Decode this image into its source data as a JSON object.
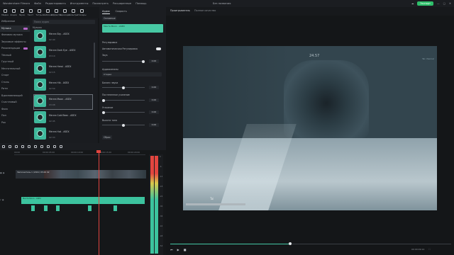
{
  "titlebar": {
    "menu": [
      "Wondershare Filmora",
      "Файл",
      "Редактировать",
      "Инструменты",
      "Посмотреть",
      "Расширенные",
      "Помощь",
      "Картик"
    ],
    "project_title": "Без названия",
    "export_label": "Экспорт"
  },
  "toolbar": {
    "tools": [
      "Медиа",
      "Акции",
      "Звуки",
      "Текст",
      "Титры",
      "Шаблоны",
      "Эффекты",
      "Переходы",
      "Фильтры",
      "Стикеры"
    ]
  },
  "sidebar": {
    "items": [
      {
        "label": "Избранное"
      },
      {
        "label": "Музыка",
        "selected": true
      },
      {
        "label": "Фоновая музыка"
      },
      {
        "label": "Звуковые эффекты"
      },
      {
        "label": "Рекомендации"
      },
      {
        "label": "Тёмный"
      },
      {
        "label": "Грустный"
      },
      {
        "label": "Мечтательный"
      },
      {
        "label": "Спорт"
      },
      {
        "label": "Стиль"
      },
      {
        "label": "Ритм"
      },
      {
        "label": "Вдохновляющий"
      },
      {
        "label": "Счастливый"
      },
      {
        "label": "Фолк"
      },
      {
        "label": "Поп"
      },
      {
        "label": "Рок"
      }
    ]
  },
  "media": {
    "search_placeholder": "Поиск аудио",
    "header": "Музыка",
    "tracks": [
      {
        "name": "Мечта Sky - ASEX",
        "duration": "02:40"
      },
      {
        "name": "Мечта Dark Eye - ASEX",
        "duration": "03:10"
      },
      {
        "name": "Мечта Heroi - ASEX",
        "duration": "02:15"
      },
      {
        "name": "Мечта Hik - ASEX",
        "duration": "02:50"
      },
      {
        "name": "Мечта Moon - ASEX",
        "duration": "03:08",
        "selected": true
      },
      {
        "name": "Мечта Cold Bear - ASEX",
        "duration": "02:45"
      },
      {
        "name": "Мечта Hot - ASEX",
        "duration": "02:33"
      }
    ]
  },
  "props": {
    "tabs": [
      "Аудио",
      "Скорость"
    ],
    "subtab": "Основные",
    "clip_label": "Мечта Moon - ASEX",
    "section": "Регулировка",
    "auto_label": "Автоматическая Регулировка",
    "volume_label": "Звук",
    "volume_value": "0.00",
    "channel_label": "Аудиоканалы",
    "channel_value": "Стерео",
    "balance_label": "Баланс звука",
    "balance_value": "0.00",
    "fade_in_label": "Постепенное усиление",
    "fade_in_value": "0.00",
    "fade_out_label": "Угасание",
    "fade_out_value": "0.00",
    "pitch_label": "Высота тона",
    "pitch_value": "0.00",
    "reset_label": "Сброс"
  },
  "preview": {
    "tabs": [
      "Проигрыватель",
      "Полное качество"
    ],
    "timestamp": "24.57",
    "watermark": "Tai channel",
    "subtitle": "Tai",
    "current_time": "00:00:09:14"
  },
  "timeline": {
    "ruler": [
      "00:00",
      "00:00:05:00",
      "00:00:10:00",
      "00:00:15:00",
      "00:00:20:00"
    ],
    "video_clip_label": "Заполнитель 1 (2021) 05:06 02",
    "audio_clip_label": "Мечта Moon - ASEX",
    "meter_scale": [
      "0",
      "-6",
      "-12",
      "-18",
      "-24",
      "-30",
      "-36",
      "-42",
      "-48",
      "-54"
    ]
  }
}
